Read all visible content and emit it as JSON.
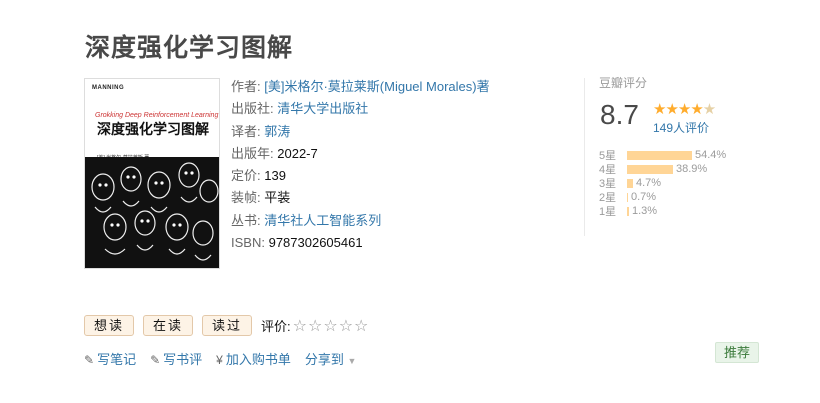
{
  "book": {
    "title": "深度强化学习图解",
    "cover": {
      "brand": "MANNING",
      "subtitle": "Grokking Deep Reinforcement Learning",
      "title": "深度强化学习图解",
      "author_mini": "[美] 米格尔·莫拉莱斯 著"
    },
    "info": {
      "author_label": "作者:",
      "author": "[美]米格尔·莫拉莱斯(Miguel Morales)著",
      "publisher_label": "出版社:",
      "publisher": "清华大学出版社",
      "translator_label": "译者:",
      "translator": "郭涛",
      "year_label": "出版年:",
      "year": "2022-7",
      "price_label": "定价:",
      "price": "139",
      "binding_label": "装帧:",
      "binding": "平装",
      "series_label": "丛书:",
      "series": "清华社人工智能系列",
      "isbn_label": "ISBN:",
      "isbn": "9787302605461"
    }
  },
  "rating": {
    "label": "豆瓣评分",
    "score": "8.7",
    "stars": 4.5,
    "votes": "149人评价",
    "distribution": [
      {
        "label": "5星",
        "pct": "54.4%",
        "value": 54.4
      },
      {
        "label": "4星",
        "pct": "38.9%",
        "value": 38.9
      },
      {
        "label": "3星",
        "pct": "4.7%",
        "value": 4.7
      },
      {
        "label": "2星",
        "pct": "0.7%",
        "value": 0.7
      },
      {
        "label": "1星",
        "pct": "1.3%",
        "value": 1.3
      }
    ]
  },
  "actions": {
    "want": "想读",
    "reading": "在读",
    "read": "读过",
    "rate_label": "评价:",
    "empty_stars": "☆☆☆☆☆"
  },
  "links": {
    "note": "写笔记",
    "review": "写书评",
    "cart": "加入购书单",
    "share": "分享到"
  },
  "recommend": "推荐",
  "colors": {
    "link": "#3377aa",
    "star": "#ffac2d",
    "bar": "#ffd596"
  }
}
